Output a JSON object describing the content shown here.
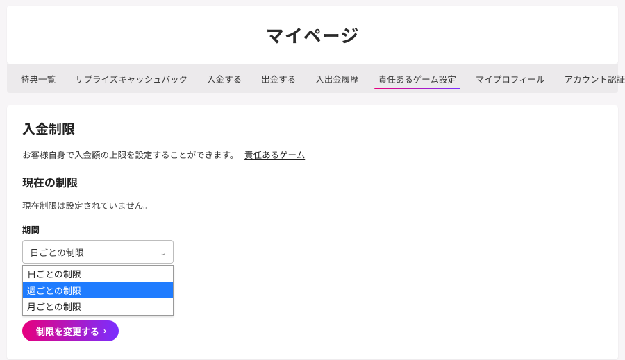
{
  "header": {
    "title": "マイページ"
  },
  "tabs": {
    "items": [
      {
        "label": "特典一覧"
      },
      {
        "label": "サプライズキャッシュバック"
      },
      {
        "label": "入金する"
      },
      {
        "label": "出金する"
      },
      {
        "label": "入出金履歴"
      },
      {
        "label": "責任あるゲーム設定"
      },
      {
        "label": "マイプロフィール"
      },
      {
        "label": "アカウント認証"
      }
    ],
    "active_index": 5
  },
  "panel": {
    "heading": "入金制限",
    "desc_text": "お客様自身で入金額の上限を設定することができます。",
    "desc_link": "責任あるゲーム",
    "sub_heading": "現在の制限",
    "current_note": "現在制限は設定されていません。",
    "period_label": "期間",
    "select_display": "日ごとの制限",
    "options": [
      {
        "label": "日ごとの制限"
      },
      {
        "label": "週ごとの制限"
      },
      {
        "label": "月ごとの制限"
      }
    ],
    "highlight_index": 1,
    "submit_label": "制限を変更する"
  }
}
